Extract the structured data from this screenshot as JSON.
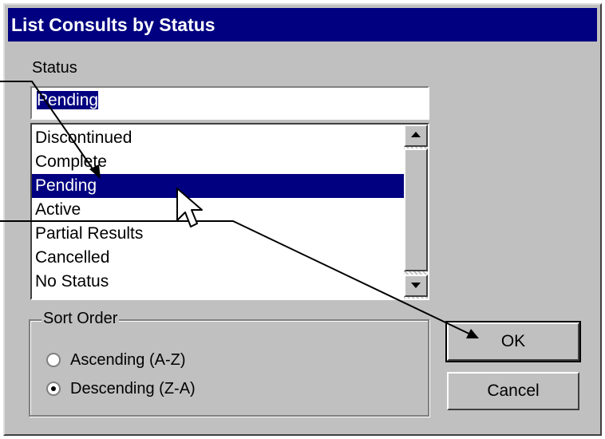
{
  "dialog": {
    "title": "List Consults by Status"
  },
  "status": {
    "label": "Status",
    "input_value": "Pending",
    "list_items": [
      "Discontinued",
      "Complete",
      "Pending",
      "Active",
      "Partial Results",
      "Cancelled",
      "No Status"
    ],
    "selected": "Pending"
  },
  "sort_order": {
    "label": "Sort Order",
    "options": [
      {
        "label": "Ascending (A-Z)",
        "checked": false
      },
      {
        "label": "Descending (Z-A)",
        "checked": true
      }
    ]
  },
  "buttons": {
    "ok": "OK",
    "cancel": "Cancel"
  },
  "colors": {
    "title_bar": "#000080",
    "face": "#c0c0c0",
    "selection": "#000080"
  },
  "icons": {
    "scroll_up": "up-arrow-icon",
    "scroll_down": "down-arrow-icon",
    "cursor": "mouse-pointer-icon"
  }
}
